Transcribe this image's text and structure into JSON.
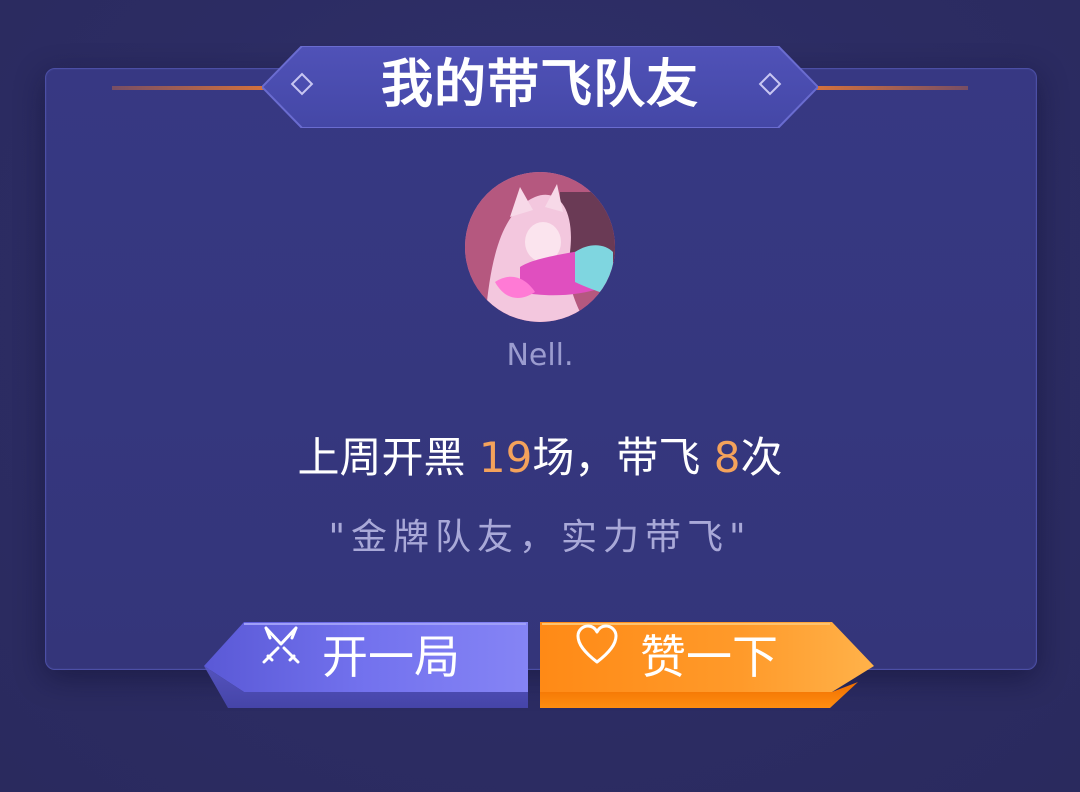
{
  "header": {
    "title": "我的带飞队友"
  },
  "teammate": {
    "name": "Nell.",
    "avatar_icon": "avatar-image"
  },
  "stats": {
    "prefix": "上周开黑 ",
    "games": "19",
    "games_unit": "场，带飞 ",
    "carries": "8",
    "carries_unit": "次"
  },
  "quote": "\"金牌队友，实力带飞\"",
  "actions": {
    "play_label": "开一局",
    "play_icon": "crossed-swords-icon",
    "like_label": "赞一下",
    "like_icon": "heart-icon"
  },
  "colors": {
    "background": "#2c2c63",
    "card": "#373883",
    "accent_orange": "#f4a25b",
    "play_button": "#6b6ae6",
    "like_button": "#ff8a1c",
    "muted_text": "#9b9ccf"
  }
}
